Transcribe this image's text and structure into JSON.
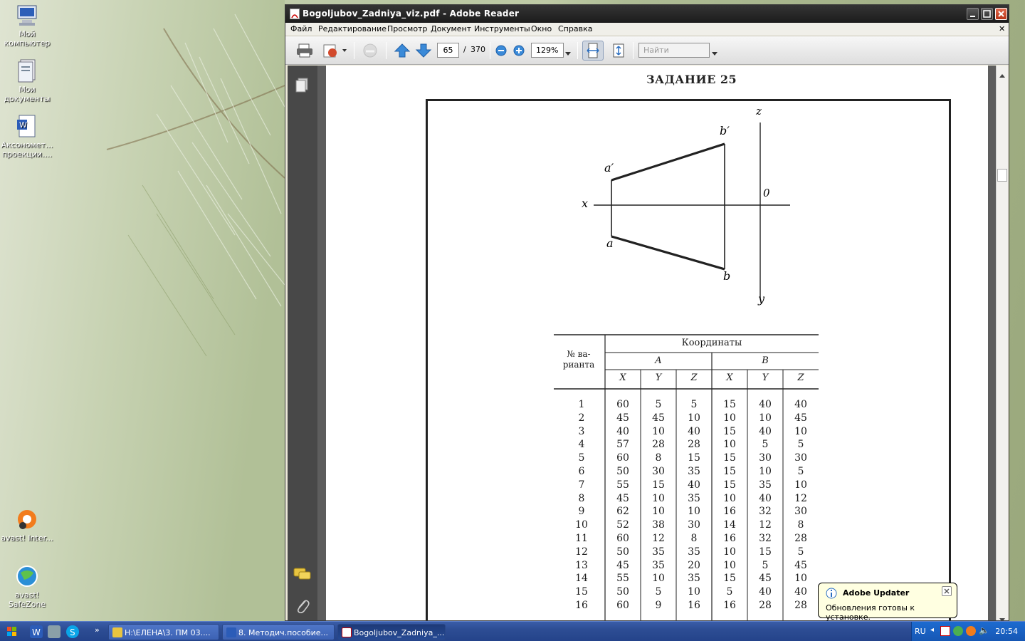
{
  "desktop": {
    "icons": [
      {
        "label": "Мой компьютер"
      },
      {
        "label": "Мои документы"
      },
      {
        "label": "Аксономет... проекции...."
      },
      {
        "label": "avast! Inter..."
      },
      {
        "label": "avast! SafeZone"
      }
    ]
  },
  "window": {
    "title": "Bogoljubov_Zadniya_viz.pdf - Adobe Reader",
    "menu": [
      "Файл",
      "Редактирование",
      "Просмотр",
      "Документ",
      "Инструменты",
      "Окно",
      "Справка"
    ],
    "toolbar": {
      "page_current": "65",
      "page_sep": "/",
      "page_total": "370",
      "zoom": "129%",
      "search_placeholder": "Найти"
    }
  },
  "document": {
    "heading": "ЗАДАНИЕ 25",
    "diagram_labels": {
      "z": "z",
      "b_prime": "b′",
      "a_prime": "a′",
      "x": "x",
      "o": "0",
      "a": "a",
      "b": "b",
      "y": "y"
    },
    "table": {
      "header_variant": "№ ва-\nрианта",
      "header_coords": "Координаты",
      "header_A": "A",
      "header_B": "B",
      "subheaders": [
        "X",
        "Y",
        "Z",
        "X",
        "Y",
        "Z"
      ],
      "rows": [
        [
          "1",
          "60",
          "5",
          "5",
          "15",
          "40",
          "40"
        ],
        [
          "2",
          "45",
          "45",
          "10",
          "10",
          "10",
          "45"
        ],
        [
          "3",
          "40",
          "10",
          "40",
          "15",
          "40",
          "10"
        ],
        [
          "4",
          "57",
          "28",
          "28",
          "10",
          "5",
          "5"
        ],
        [
          "5",
          "60",
          "8",
          "15",
          "15",
          "30",
          "30"
        ],
        [
          "6",
          "50",
          "30",
          "35",
          "15",
          "10",
          "5"
        ],
        [
          "7",
          "55",
          "15",
          "40",
          "15",
          "35",
          "10"
        ],
        [
          "8",
          "45",
          "10",
          "35",
          "10",
          "40",
          "12"
        ],
        [
          "9",
          "62",
          "10",
          "10",
          "16",
          "32",
          "30"
        ],
        [
          "10",
          "52",
          "38",
          "30",
          "14",
          "12",
          "8"
        ],
        [
          "11",
          "60",
          "12",
          "8",
          "16",
          "32",
          "28"
        ],
        [
          "12",
          "50",
          "35",
          "35",
          "10",
          "15",
          "5"
        ],
        [
          "13",
          "45",
          "35",
          "20",
          "10",
          "5",
          "45"
        ],
        [
          "14",
          "55",
          "10",
          "35",
          "15",
          "45",
          "10"
        ],
        [
          "15",
          "50",
          "5",
          "10",
          "5",
          "40",
          "40"
        ],
        [
          "16",
          "60",
          "9",
          "16",
          "16",
          "28",
          "28"
        ]
      ]
    }
  },
  "balloon": {
    "title": "Adobe Updater",
    "message": "Обновления готовы к установке."
  },
  "taskbar": {
    "buttons": [
      {
        "label": "H:\\ЕЛЕНА\\3. ПМ 03...."
      },
      {
        "label": "8. Методич.пособие..."
      },
      {
        "label": "Bogoljubov_Zadniya_..."
      }
    ],
    "lang": "RU",
    "clock": "20:54"
  },
  "colors": {
    "titlebar": "#262626",
    "taskbar": "#2d4d94",
    "balloon_bg": "#ffffe1"
  }
}
